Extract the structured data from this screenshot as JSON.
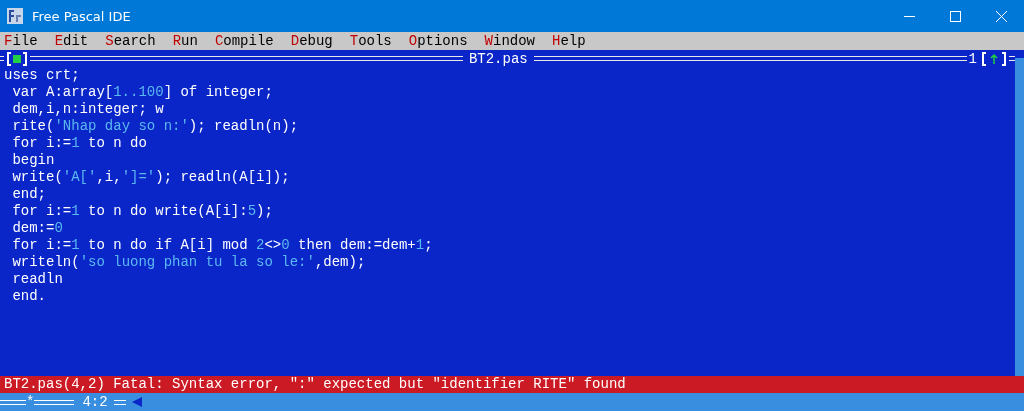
{
  "window": {
    "title": "Free Pascal IDE"
  },
  "menu": [
    {
      "label": "File"
    },
    {
      "label": "Edit"
    },
    {
      "label": "Search"
    },
    {
      "label": "Run"
    },
    {
      "label": "Compile"
    },
    {
      "label": "Debug"
    },
    {
      "label": "Tools"
    },
    {
      "label": "Options"
    },
    {
      "label": "Window"
    },
    {
      "label": "Help"
    }
  ],
  "editor": {
    "title": "BT2.pas",
    "window_number": "1",
    "lines": [
      [
        {
          "text": "uses crt;",
          "kind": "plain"
        }
      ],
      [
        {
          "text": " var A:array[",
          "kind": "plain"
        },
        {
          "text": "1..100",
          "kind": "literal"
        },
        {
          "text": "] of integer;",
          "kind": "plain"
        }
      ],
      [
        {
          "text": " dem,i,n:integer; w",
          "kind": "plain"
        }
      ],
      [
        {
          "text": " rite(",
          "kind": "plain"
        },
        {
          "text": "'Nhap day so n:'",
          "kind": "literal"
        },
        {
          "text": "); readln(n);",
          "kind": "plain"
        }
      ],
      [
        {
          "text": " for i:=",
          "kind": "plain"
        },
        {
          "text": "1",
          "kind": "literal"
        },
        {
          "text": " to n do",
          "kind": "plain"
        }
      ],
      [
        {
          "text": " begin",
          "kind": "plain"
        }
      ],
      [
        {
          "text": " write(",
          "kind": "plain"
        },
        {
          "text": "'A['",
          "kind": "literal"
        },
        {
          "text": ",i,",
          "kind": "plain"
        },
        {
          "text": "']='",
          "kind": "literal"
        },
        {
          "text": "); readln(A[i]);",
          "kind": "plain"
        }
      ],
      [
        {
          "text": " end;",
          "kind": "plain"
        }
      ],
      [
        {
          "text": " for i:=",
          "kind": "plain"
        },
        {
          "text": "1",
          "kind": "literal"
        },
        {
          "text": " to n do write(A[i]:",
          "kind": "plain"
        },
        {
          "text": "5",
          "kind": "literal"
        },
        {
          "text": ");",
          "kind": "plain"
        }
      ],
      [
        {
          "text": " dem:=",
          "kind": "plain"
        },
        {
          "text": "0",
          "kind": "literal"
        }
      ],
      [
        {
          "text": " for i:=",
          "kind": "plain"
        },
        {
          "text": "1",
          "kind": "literal"
        },
        {
          "text": " to n do if A[i] mod ",
          "kind": "plain"
        },
        {
          "text": "2",
          "kind": "literal"
        },
        {
          "text": "<>",
          "kind": "plain"
        },
        {
          "text": "0",
          "kind": "literal"
        },
        {
          "text": " then dem:=dem+",
          "kind": "plain"
        },
        {
          "text": "1",
          "kind": "literal"
        },
        {
          "text": ";",
          "kind": "plain"
        }
      ],
      [
        {
          "text": " writeln(",
          "kind": "plain"
        },
        {
          "text": "'so luong phan tu la so le:'",
          "kind": "literal"
        },
        {
          "text": ",dem);",
          "kind": "plain"
        }
      ],
      [
        {
          "text": " readln",
          "kind": "plain"
        }
      ],
      [
        {
          "text": " end.",
          "kind": "plain"
        }
      ]
    ]
  },
  "error_message": "BT2.pas(4,2) Fatal: Syntax error, \":\" expected but \"identifier RITE\" found",
  "status": {
    "modified_mark": "*",
    "cursor": "4:2"
  }
}
